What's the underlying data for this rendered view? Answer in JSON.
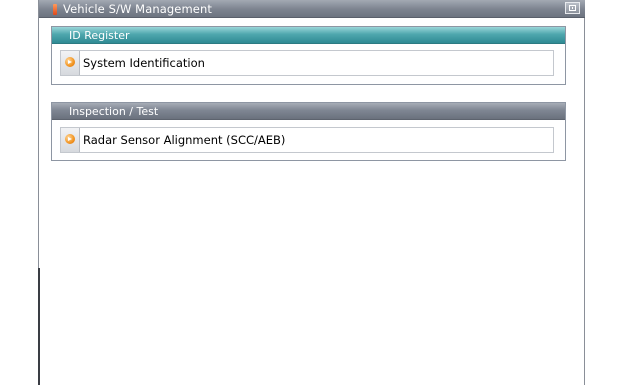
{
  "window": {
    "title": "Vehicle S/W Management",
    "title_icon": "wrench-flag-icon",
    "control_icon": "window-grid-icon"
  },
  "groups": [
    {
      "header": "ID Register",
      "header_color": "#3f9aa2",
      "items": [
        {
          "label": "System Identification",
          "icon": "orange-arrow-icon"
        }
      ]
    },
    {
      "header": "Inspection / Test",
      "header_color": "#7a818d",
      "items": [
        {
          "label": "Radar Sensor Alignment (SCC/AEB)",
          "icon": "orange-arrow-icon"
        }
      ]
    }
  ]
}
